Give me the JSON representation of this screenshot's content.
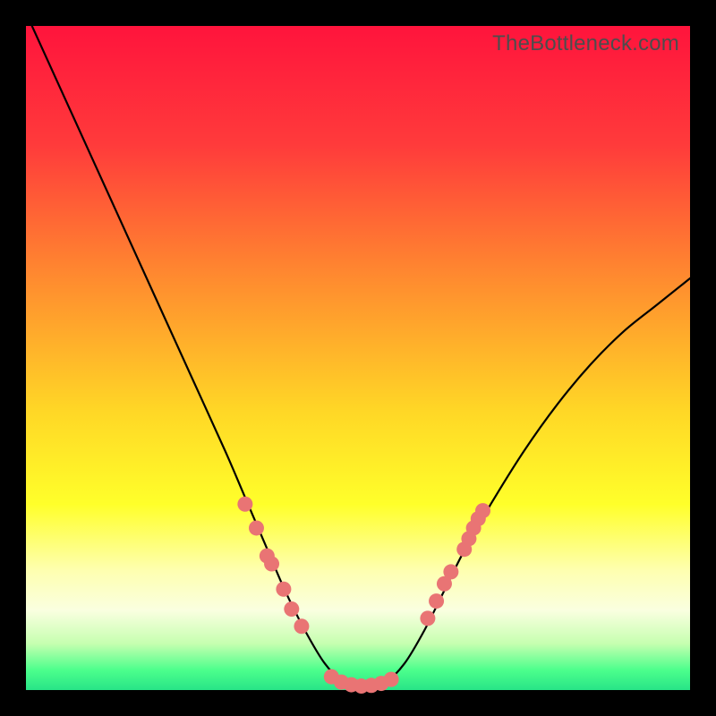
{
  "watermark": "TheBottleneck.com",
  "gradient_stops": [
    {
      "pct": 0,
      "color": "#ff143c"
    },
    {
      "pct": 18,
      "color": "#ff3b3b"
    },
    {
      "pct": 38,
      "color": "#ff8b2f"
    },
    {
      "pct": 58,
      "color": "#ffd726"
    },
    {
      "pct": 72,
      "color": "#ffff2a"
    },
    {
      "pct": 82,
      "color": "#feffb0"
    },
    {
      "pct": 88,
      "color": "#faffe0"
    },
    {
      "pct": 93,
      "color": "#c6ffb0"
    },
    {
      "pct": 97,
      "color": "#4cff8c"
    },
    {
      "pct": 100,
      "color": "#28e487"
    }
  ],
  "curve_color": "#000000",
  "marker_color": "#e97474",
  "chart_data": {
    "type": "line",
    "title": "",
    "xlabel": "",
    "ylabel": "",
    "xlim": [
      0,
      100
    ],
    "ylim": [
      0,
      100
    ],
    "grid": false,
    "series": [
      {
        "name": "bottleneck-curve",
        "x": [
          0,
          5,
          10,
          15,
          20,
          25,
          30,
          33,
          36,
          39,
          42,
          45,
          48,
          51,
          54,
          57,
          60,
          63,
          66,
          70,
          75,
          80,
          85,
          90,
          95,
          100
        ],
        "y": [
          102,
          91,
          80,
          69,
          58,
          47,
          36,
          29,
          22,
          15,
          9,
          4,
          1,
          0,
          1,
          4,
          9,
          15,
          21,
          28,
          36,
          43,
          49,
          54,
          58,
          62
        ]
      }
    ],
    "markers": [
      {
        "x": 33.0,
        "y": 28.0
      },
      {
        "x": 34.7,
        "y": 24.4
      },
      {
        "x": 36.3,
        "y": 20.2
      },
      {
        "x": 37.0,
        "y": 19.0
      },
      {
        "x": 38.8,
        "y": 15.2
      },
      {
        "x": 40.0,
        "y": 12.2
      },
      {
        "x": 41.5,
        "y": 9.6
      },
      {
        "x": 46.0,
        "y": 2.0
      },
      {
        "x": 47.5,
        "y": 1.2
      },
      {
        "x": 49.0,
        "y": 0.8
      },
      {
        "x": 50.5,
        "y": 0.6
      },
      {
        "x": 52.0,
        "y": 0.7
      },
      {
        "x": 53.5,
        "y": 1.0
      },
      {
        "x": 55.0,
        "y": 1.6
      },
      {
        "x": 60.5,
        "y": 10.8
      },
      {
        "x": 61.8,
        "y": 13.4
      },
      {
        "x": 63.0,
        "y": 16.0
      },
      {
        "x": 64.0,
        "y": 17.8
      },
      {
        "x": 66.0,
        "y": 21.2
      },
      {
        "x": 66.7,
        "y": 22.8
      },
      {
        "x": 67.4,
        "y": 24.4
      },
      {
        "x": 68.1,
        "y": 25.8
      },
      {
        "x": 68.8,
        "y": 27.0
      }
    ]
  }
}
